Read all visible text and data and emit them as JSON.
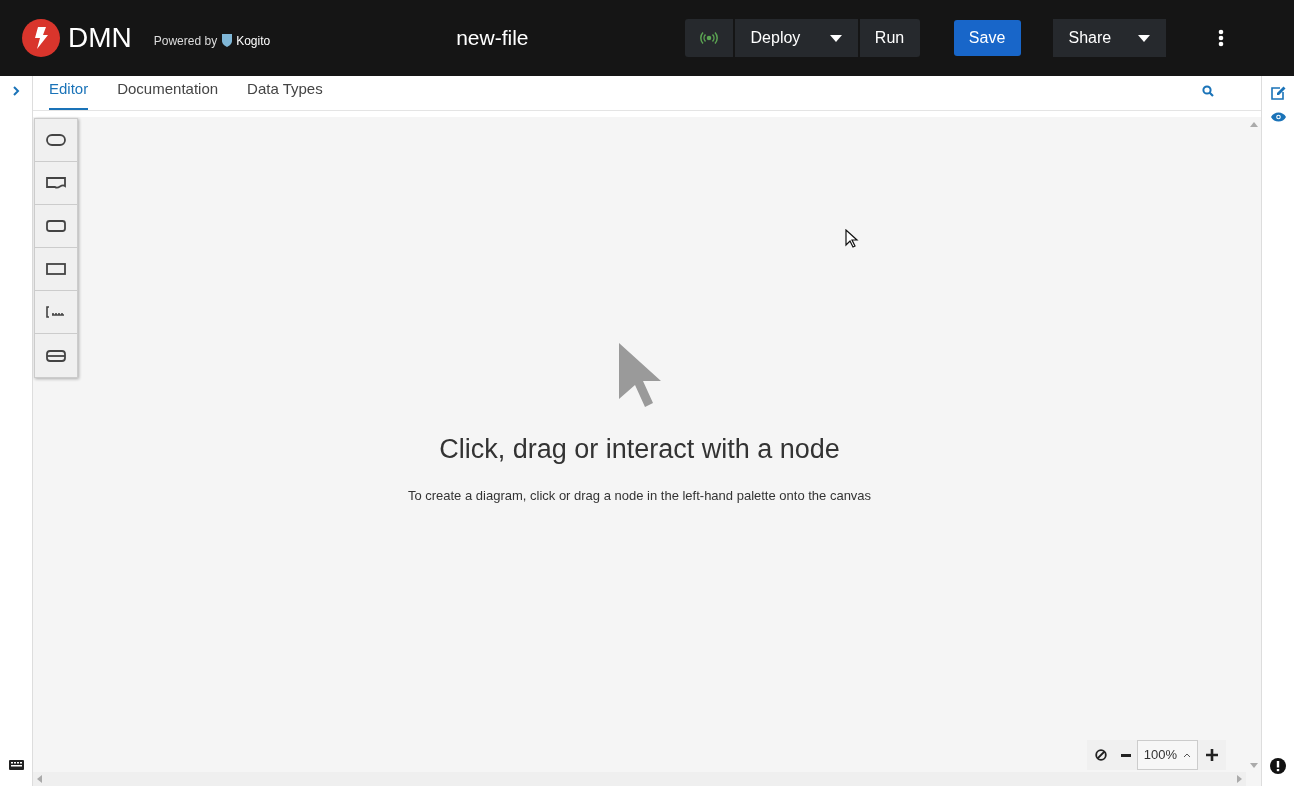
{
  "header": {
    "logo": "DMN",
    "powered_by": "Powered by",
    "kogito": "Kogito",
    "file_name": "new-file",
    "deploy": "Deploy",
    "run": "Run",
    "save": "Save",
    "share": "Share"
  },
  "tabs": [
    {
      "label": "Editor",
      "selected": true
    },
    {
      "label": "Documentation",
      "selected": false
    },
    {
      "label": "Data Types",
      "selected": false
    }
  ],
  "empty_state": {
    "title": "Click, drag or interact with a node",
    "message": "To create a diagram, click or drag a node in the left-hand palette onto the canvas"
  },
  "zoom": {
    "value": "100%"
  }
}
